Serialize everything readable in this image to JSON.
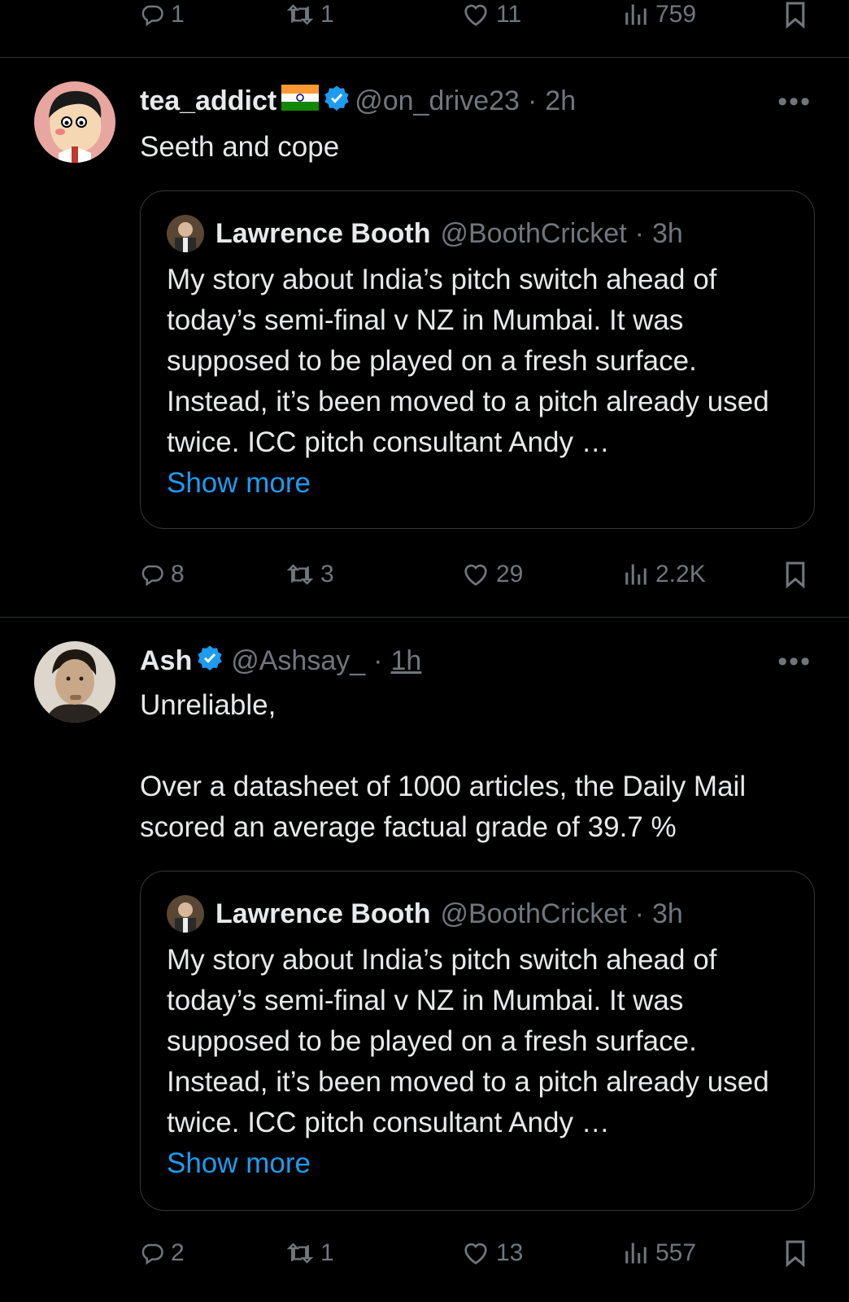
{
  "top_bar": {
    "replies": "1",
    "retweets": "1",
    "likes": "11",
    "views": "759"
  },
  "tweets": [
    {
      "name": "tea_addict",
      "handle": "@on_drive23",
      "dot": "·",
      "time": "2h",
      "more": "•••",
      "text": "Seeth and cope",
      "quote": {
        "name": "Lawrence Booth",
        "handle": "@BoothCricket",
        "dot": "·",
        "time": "3h",
        "text": "My story about India’s pitch switch ahead of today’s semi-final v NZ in Mumbai. It was supposed to be played on a fresh surface. Instead, it’s been moved to a pitch already used twice. ICC pitch consultant Andy …",
        "show_more": "Show more"
      },
      "actions": {
        "replies": "8",
        "retweets": "3",
        "likes": "29",
        "views": "2.2K"
      }
    },
    {
      "name": "Ash",
      "handle": "@Ashsay_",
      "dot": "·",
      "time": "1h",
      "more": "•••",
      "text_line1": "Unreliable,",
      "text_line2": "Over a datasheet of 1000 articles, the Daily Mail scored an average factual grade of 39.7 %",
      "quote": {
        "name": "Lawrence Booth",
        "handle": "@BoothCricket",
        "dot": "·",
        "time": "3h",
        "text": "My story about India’s pitch switch ahead of today’s semi-final v NZ in Mumbai. It was supposed to be played on a fresh surface. Instead, it’s been moved to a pitch already used twice. ICC pitch consultant Andy …",
        "show_more": "Show more"
      },
      "actions": {
        "replies": "2",
        "retweets": "1",
        "likes": "13",
        "views": "557"
      }
    }
  ],
  "colors": {
    "background": "#000000",
    "text": "#e7e9ea",
    "muted": "#71767b",
    "link": "#1d9bf0",
    "verified": "#1d9bf0",
    "divider": "#2f3336"
  }
}
